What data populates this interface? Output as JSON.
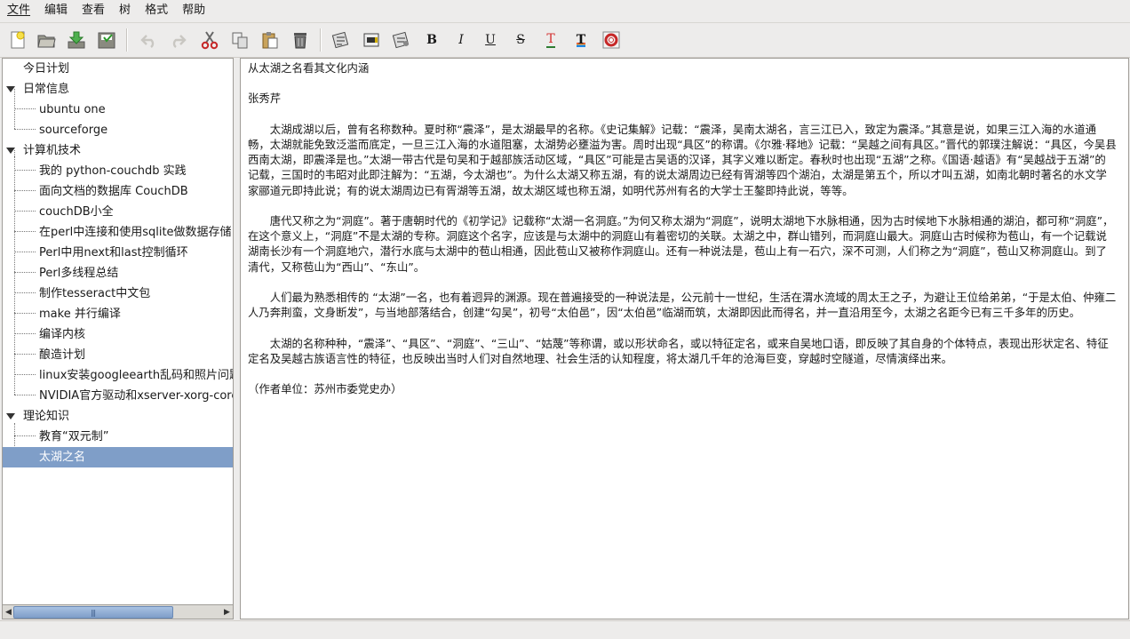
{
  "menu": [
    "文件",
    "编辑",
    "查看",
    "树",
    "格式",
    "帮助"
  ],
  "toolbar": {
    "icons": [
      "new-file-icon",
      "open-folder-icon",
      "download-icon",
      "save-icon",
      "undo-icon",
      "redo-icon",
      "cut-icon",
      "copy-icon",
      "paste-icon",
      "delete-icon",
      "format-a-icon",
      "format-b-icon",
      "format-c-icon",
      "bold-icon",
      "italic-icon",
      "underline-icon",
      "strikethrough-icon",
      "text-color-icon",
      "highlight-icon",
      "lifebuoy-icon"
    ],
    "bold_label": "B",
    "italic_label": "I",
    "underline_label": "U",
    "strike_label": "S",
    "color_label": "T",
    "highlight_label": "T"
  },
  "tree": {
    "top": {
      "label": "今日计划"
    },
    "groups": [
      {
        "label": "日常信息",
        "children": [
          "ubuntu one",
          "sourceforge"
        ]
      },
      {
        "label": "计算机技术",
        "children": [
          "我的 python-couchdb 实践",
          "面向文档的数据库 CouchDB",
          "couchDB小全",
          "在perl中连接和使用sqlite做数据存储",
          "Perl中用next和last控制循环",
          "Perl多线程总结",
          "制作tesseract中文包",
          "make 并行编译",
          "编译内核",
          "酿造计划",
          "linux安装googleearth乱码和照片问题",
          "NVIDIA官方驱动和xserver-xorg-core"
        ]
      },
      {
        "label": "理论知识",
        "children": [
          "教育“双元制”",
          "太湖之名"
        ]
      }
    ],
    "selected": "太湖之名"
  },
  "document": {
    "title": "从太湖之名看其文化内涵",
    "author": "张秀芹",
    "paragraphs": [
      "　　太湖成湖以后，曾有名称数种。夏时称“震泽”，是太湖最早的名称。《史记集解》记载：“震泽，吴南太湖名，言三江已入，致定为震泽。”其意是说，如果三江入海的水道通畅，太湖就能免致泛滥而底定，一旦三江入海的水道阻塞，太湖势必壅溢为害。周时出现“具区”的称谓。《尔雅·释地》记载：“吴越之间有具区。”晋代的郭璞注解说：“具区，今吴县西南太湖，即震泽是也。”太湖一带古代是句吴和于越部族活动区域，“具区”可能是古吴语的汉译，其字义难以断定。春秋时也出现“五湖”之称。《国语·越语》有“吴越战于五湖”的记载，三国时的韦昭对此即注解为：“五湖，今太湖也”。为什么太湖又称五湖，有的说太湖周边已经有胥湖等四个湖泊，太湖是第五个，所以才叫五湖，如南北朝时著名的水文学家郦道元即持此说；有的说太湖周边已有胥湖等五湖，故太湖区域也称五湖，如明代苏州有名的大学士王鏊即持此说，等等。",
      "　　唐代又称之为“洞庭”。著于唐朝时代的《初学记》记载称“太湖一名洞庭。”为何又称太湖为“洞庭”，说明太湖地下水脉相通，因为古时候地下水脉相通的湖泊，都可称“洞庭”，在这个意义上，“洞庭”不是太湖的专称。洞庭这个名字，应该是与太湖中的洞庭山有着密切的关联。太湖之中，群山错列，而洞庭山最大。洞庭山古时候称为苞山，有一个记载说湖南长沙有一个洞庭地穴，潜行水底与太湖中的苞山相通，因此苞山又被称作洞庭山。还有一种说法是，苞山上有一石穴，深不可测，人们称之为“洞庭”，苞山又称洞庭山。到了清代，又称苞山为“西山”、“东山”。",
      "　　人们最为熟悉相传的 “太湖”一名，也有着迥异的渊源。现在普遍接受的一种说法是，公元前十一世纪，生活在渭水流域的周太王之子，为避让王位给弟弟，“于是太伯、仲雍二人乃奔荆蛮，文身断发”，与当地部落结合，创建“勾吴”，初号“太伯邑”，因“太伯邑”临湖而筑，太湖即因此而得名，并一直沿用至今，太湖之名距今已有三千多年的历史。",
      "　　太湖的名称种种，“震泽”、“具区”、“洞庭”、“三山”、“姑蔑”等称谓，或以形状命名，或以特征定名，或来自吴地口语，即反映了其自身的个体特点，表现出形状定名、特征定名及吴越古族语言性的特征，也反映出当时人们对自然地理、社会生活的认知程度，将太湖几千年的沧海巨变，穿越时空隧道，尽情演绎出来。"
    ],
    "footer": "（作者单位：苏州市委党史办）"
  }
}
